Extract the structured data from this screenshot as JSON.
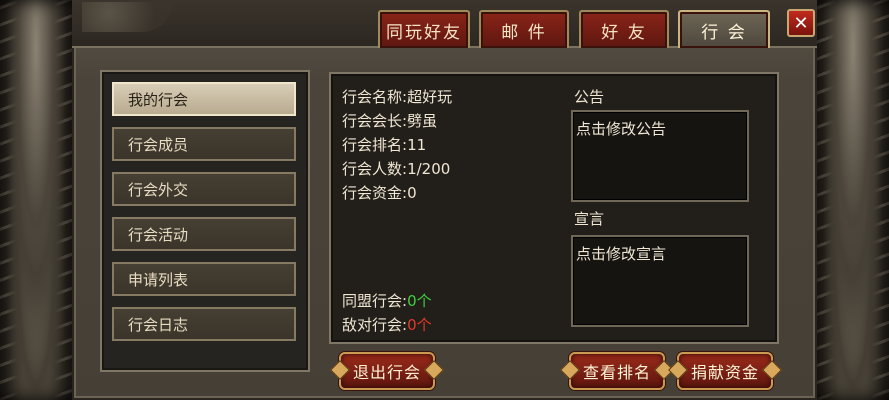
{
  "tabs": [
    {
      "label": "同玩好友",
      "active": false
    },
    {
      "label": "邮 件",
      "active": false
    },
    {
      "label": "好 友",
      "active": false
    },
    {
      "label": "行 会",
      "active": true
    }
  ],
  "close_label": "✕",
  "menu": {
    "items": [
      {
        "label": "我的行会",
        "active": true
      },
      {
        "label": "行会成员",
        "active": false
      },
      {
        "label": "行会外交",
        "active": false
      },
      {
        "label": "行会活动",
        "active": false
      },
      {
        "label": "申请列表",
        "active": false
      },
      {
        "label": "行会日志",
        "active": false
      }
    ]
  },
  "guild": {
    "name_label": "行会名称:",
    "name": "超好玩",
    "leader_label": "行会会长:",
    "leader": "劈虽",
    "rank_label": "行会排名:",
    "rank": "11",
    "members_label": "行会人数:",
    "members": "1/200",
    "funds_label": "行会资金:",
    "funds": "0",
    "allies_label": "同盟行会:",
    "allies": "0个",
    "enemies_label": "敌对行会:",
    "enemies": "0个"
  },
  "notice": {
    "title": "公告",
    "text": "点击修改公告"
  },
  "declaration": {
    "title": "宣言",
    "text": "点击修改宣言"
  },
  "buttons": {
    "leave": "退出行会",
    "view_rank": "查看排名",
    "donate": "捐献资金"
  },
  "colors": {
    "accent_red": "#8a2418",
    "ally_green": "#3fd03f",
    "enemy_red": "#e23a2a"
  }
}
